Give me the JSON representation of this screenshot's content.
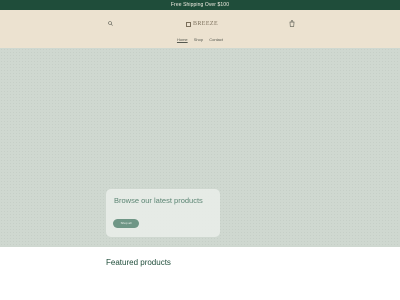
{
  "announcement": "Free Shipping Over $100",
  "header": {
    "logo_text": "BREEZE",
    "icons": {
      "search": "search-icon",
      "cart": "cart-icon"
    },
    "nav": [
      "Home",
      "Shop",
      "Contact"
    ],
    "active_nav": "Home"
  },
  "hero": {
    "heading": "Browse our latest products",
    "button_label": "Shop all"
  },
  "featured": {
    "title": "Featured products"
  },
  "colors": {
    "announcement_bg": "#1f4d3a",
    "header_bg": "#ece2d0",
    "hero_bg": "#cfd8d0",
    "accent": "#6f9686",
    "heading_green": "#5b8573"
  }
}
